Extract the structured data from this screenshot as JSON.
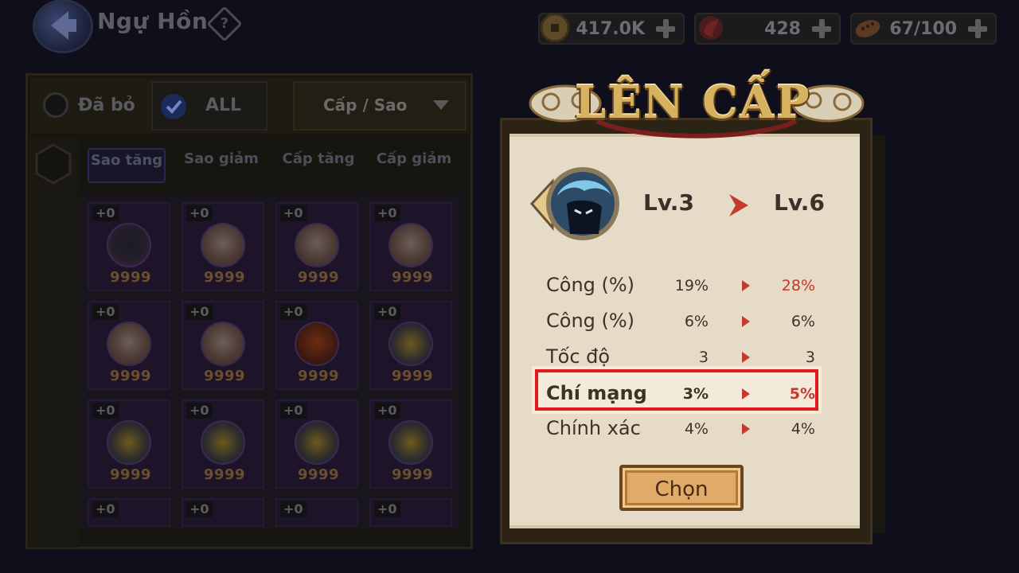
{
  "header": {
    "title": "Ngự Hồn",
    "help_symbol": "?",
    "back_icon": "back-arrow-icon"
  },
  "resources": [
    {
      "icon": "coin-icon",
      "value": "417.0K"
    },
    {
      "icon": "flame-orb-icon",
      "value": "428"
    },
    {
      "icon": "stamina-icon",
      "value": "67/100"
    }
  ],
  "filters": {
    "discarded_label": "Đã bỏ",
    "all_label": "ALL",
    "all_checked": true,
    "sort_label": "Cấp / Sao"
  },
  "sort_tabs": [
    "Sao tăng",
    "Sao giảm",
    "Cấp tăng",
    "Cấp giảm"
  ],
  "active_sort_tab": "Sao tăng",
  "inventory": [
    {
      "level": "+0",
      "count": "9999",
      "art": "dark-fox-spirit"
    },
    {
      "level": "+0",
      "count": "9999",
      "art": "white-hair-spirit"
    },
    {
      "level": "+0",
      "count": "9999",
      "art": "white-hair-spirit"
    },
    {
      "level": "+0",
      "count": "9999",
      "art": "white-hair-spirit"
    },
    {
      "level": "+0",
      "count": "9999",
      "art": "white-hair-spirit"
    },
    {
      "level": "+0",
      "count": "9999",
      "art": "white-hair-spirit"
    },
    {
      "level": "+0",
      "count": "9999",
      "art": "fire-dragon-spirit"
    },
    {
      "level": "+0",
      "count": "9999",
      "art": "lightning-spirit"
    },
    {
      "level": "+0",
      "count": "9999",
      "art": "lightning-spirit"
    },
    {
      "level": "+0",
      "count": "9999",
      "art": "lightning-spirit"
    },
    {
      "level": "+0",
      "count": "9999",
      "art": "lightning-spirit"
    },
    {
      "level": "+0",
      "count": "9999",
      "art": "lightning-spirit"
    },
    {
      "level": "+0",
      "count": "",
      "art": "unknown"
    },
    {
      "level": "+0",
      "count": "",
      "art": "unknown"
    },
    {
      "level": "+0",
      "count": "",
      "art": "unknown"
    },
    {
      "level": "+0",
      "count": "",
      "art": "unknown"
    }
  ],
  "dialog": {
    "title": "LÊN CẤP",
    "level_from": "Lv.3",
    "level_to": "Lv.6",
    "stats": [
      {
        "name": "Công (%)",
        "from": "19%",
        "to": "28%",
        "increased": true
      },
      {
        "name": "Công (%)",
        "from": "6%",
        "to": "6%",
        "increased": false
      },
      {
        "name": "Tốc độ",
        "from": "3",
        "to": "3",
        "increased": false
      },
      {
        "name": "Chí mạng",
        "from": "3%",
        "to": "5%",
        "increased": true
      },
      {
        "name": "Chính xác",
        "from": "4%",
        "to": "4%",
        "increased": false
      }
    ],
    "highlighted_stat": "Chí mạng",
    "choose_label": "Chọn"
  },
  "colors": {
    "highlight_border": "#e01a1a",
    "increase_value": "#c0392b",
    "paper": "#e6dbc6",
    "banner_gold": "#d6b260"
  }
}
